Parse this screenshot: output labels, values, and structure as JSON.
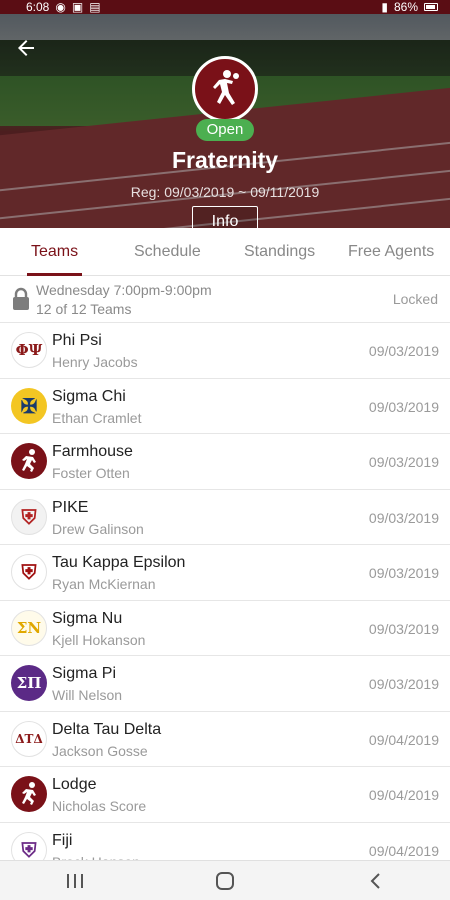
{
  "status": {
    "time": "6:08",
    "battery": "86%"
  },
  "hero": {
    "title": "Fraternity",
    "badge": "Open",
    "reg": "Reg: 09/03/2019 ~ 09/11/2019",
    "info_label": "Info"
  },
  "tabs": [
    {
      "label": "Teams",
      "active": true
    },
    {
      "label": "Schedule",
      "active": false
    },
    {
      "label": "Standings",
      "active": false
    },
    {
      "label": "Free Agents",
      "active": false
    }
  ],
  "league": {
    "time": "Wednesday 7:00pm-9:00pm",
    "count": "12 of 12 Teams",
    "status": "Locked"
  },
  "teams": [
    {
      "name": "Phi Psi",
      "captain": "Henry Jacobs",
      "date": "09/03/2019",
      "logo_text": "ΦΨ",
      "logo_bg": "#ffffff",
      "logo_color": "#8b1a1a"
    },
    {
      "name": "Sigma Chi",
      "captain": "Ethan Cramlet",
      "date": "09/03/2019",
      "logo_text": "✠",
      "logo_bg": "#f3c623",
      "logo_color": "#1a3a6b"
    },
    {
      "name": "Farmhouse",
      "captain": "Foster Otten",
      "date": "09/03/2019",
      "logo_text": "",
      "logo_bg": "#7a1118",
      "logo_color": "#ffffff"
    },
    {
      "name": "PIKE",
      "captain": "Drew Galinson",
      "date": "09/03/2019",
      "logo_text": "⛨",
      "logo_bg": "#f2f2f2",
      "logo_color": "#b22222"
    },
    {
      "name": "Tau Kappa Epsilon",
      "captain": "Ryan McKiernan",
      "date": "09/03/2019",
      "logo_text": "⛨",
      "logo_bg": "#ffffff",
      "logo_color": "#a01010"
    },
    {
      "name": "Sigma Nu",
      "captain": "Kjell Hokanson",
      "date": "09/03/2019",
      "logo_text": "ΣΝ",
      "logo_bg": "#fffbea",
      "logo_color": "#e0a800"
    },
    {
      "name": "Sigma Pi",
      "captain": "Will Nelson",
      "date": "09/03/2019",
      "logo_text": "ΣΠ",
      "logo_bg": "#5b2a86",
      "logo_color": "#ffffff"
    },
    {
      "name": "Delta Tau Delta",
      "captain": "Jackson Gosse",
      "date": "09/04/2019",
      "logo_text": "ΔΤΔ",
      "logo_bg": "#ffffff",
      "logo_color": "#8b1a1a"
    },
    {
      "name": "Lodge",
      "captain": "Nicholas Score",
      "date": "09/04/2019",
      "logo_text": "",
      "logo_bg": "#7a1118",
      "logo_color": "#ffffff"
    },
    {
      "name": "Fiji",
      "captain": "Brock Hansen",
      "date": "09/04/2019",
      "logo_text": "⛨",
      "logo_bg": "#ffffff",
      "logo_color": "#6b2a86"
    }
  ],
  "colors": {
    "brand": "#7a1118",
    "open": "#4caf50"
  },
  "icons": {
    "back": "arrow-left-icon",
    "lock": "lock-icon",
    "nav": [
      "recent-apps-icon",
      "home-icon",
      "back-nav-icon"
    ]
  }
}
